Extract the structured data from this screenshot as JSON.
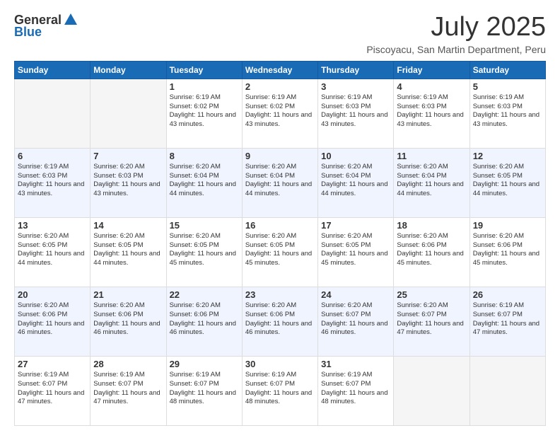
{
  "logo": {
    "general": "General",
    "blue": "Blue"
  },
  "title": "July 2025",
  "location": "Piscoyacu, San Martin Department, Peru",
  "days_of_week": [
    "Sunday",
    "Monday",
    "Tuesday",
    "Wednesday",
    "Thursday",
    "Friday",
    "Saturday"
  ],
  "weeks": [
    [
      {
        "day": "",
        "sunrise": "",
        "sunset": "",
        "daylight": ""
      },
      {
        "day": "",
        "sunrise": "",
        "sunset": "",
        "daylight": ""
      },
      {
        "day": "1",
        "sunrise": "Sunrise: 6:19 AM",
        "sunset": "Sunset: 6:02 PM",
        "daylight": "Daylight: 11 hours and 43 minutes."
      },
      {
        "day": "2",
        "sunrise": "Sunrise: 6:19 AM",
        "sunset": "Sunset: 6:02 PM",
        "daylight": "Daylight: 11 hours and 43 minutes."
      },
      {
        "day": "3",
        "sunrise": "Sunrise: 6:19 AM",
        "sunset": "Sunset: 6:03 PM",
        "daylight": "Daylight: 11 hours and 43 minutes."
      },
      {
        "day": "4",
        "sunrise": "Sunrise: 6:19 AM",
        "sunset": "Sunset: 6:03 PM",
        "daylight": "Daylight: 11 hours and 43 minutes."
      },
      {
        "day": "5",
        "sunrise": "Sunrise: 6:19 AM",
        "sunset": "Sunset: 6:03 PM",
        "daylight": "Daylight: 11 hours and 43 minutes."
      }
    ],
    [
      {
        "day": "6",
        "sunrise": "Sunrise: 6:19 AM",
        "sunset": "Sunset: 6:03 PM",
        "daylight": "Daylight: 11 hours and 43 minutes."
      },
      {
        "day": "7",
        "sunrise": "Sunrise: 6:20 AM",
        "sunset": "Sunset: 6:03 PM",
        "daylight": "Daylight: 11 hours and 43 minutes."
      },
      {
        "day": "8",
        "sunrise": "Sunrise: 6:20 AM",
        "sunset": "Sunset: 6:04 PM",
        "daylight": "Daylight: 11 hours and 44 minutes."
      },
      {
        "day": "9",
        "sunrise": "Sunrise: 6:20 AM",
        "sunset": "Sunset: 6:04 PM",
        "daylight": "Daylight: 11 hours and 44 minutes."
      },
      {
        "day": "10",
        "sunrise": "Sunrise: 6:20 AM",
        "sunset": "Sunset: 6:04 PM",
        "daylight": "Daylight: 11 hours and 44 minutes."
      },
      {
        "day": "11",
        "sunrise": "Sunrise: 6:20 AM",
        "sunset": "Sunset: 6:04 PM",
        "daylight": "Daylight: 11 hours and 44 minutes."
      },
      {
        "day": "12",
        "sunrise": "Sunrise: 6:20 AM",
        "sunset": "Sunset: 6:05 PM",
        "daylight": "Daylight: 11 hours and 44 minutes."
      }
    ],
    [
      {
        "day": "13",
        "sunrise": "Sunrise: 6:20 AM",
        "sunset": "Sunset: 6:05 PM",
        "daylight": "Daylight: 11 hours and 44 minutes."
      },
      {
        "day": "14",
        "sunrise": "Sunrise: 6:20 AM",
        "sunset": "Sunset: 6:05 PM",
        "daylight": "Daylight: 11 hours and 44 minutes."
      },
      {
        "day": "15",
        "sunrise": "Sunrise: 6:20 AM",
        "sunset": "Sunset: 6:05 PM",
        "daylight": "Daylight: 11 hours and 45 minutes."
      },
      {
        "day": "16",
        "sunrise": "Sunrise: 6:20 AM",
        "sunset": "Sunset: 6:05 PM",
        "daylight": "Daylight: 11 hours and 45 minutes."
      },
      {
        "day": "17",
        "sunrise": "Sunrise: 6:20 AM",
        "sunset": "Sunset: 6:05 PM",
        "daylight": "Daylight: 11 hours and 45 minutes."
      },
      {
        "day": "18",
        "sunrise": "Sunrise: 6:20 AM",
        "sunset": "Sunset: 6:06 PM",
        "daylight": "Daylight: 11 hours and 45 minutes."
      },
      {
        "day": "19",
        "sunrise": "Sunrise: 6:20 AM",
        "sunset": "Sunset: 6:06 PM",
        "daylight": "Daylight: 11 hours and 45 minutes."
      }
    ],
    [
      {
        "day": "20",
        "sunrise": "Sunrise: 6:20 AM",
        "sunset": "Sunset: 6:06 PM",
        "daylight": "Daylight: 11 hours and 46 minutes."
      },
      {
        "day": "21",
        "sunrise": "Sunrise: 6:20 AM",
        "sunset": "Sunset: 6:06 PM",
        "daylight": "Daylight: 11 hours and 46 minutes."
      },
      {
        "day": "22",
        "sunrise": "Sunrise: 6:20 AM",
        "sunset": "Sunset: 6:06 PM",
        "daylight": "Daylight: 11 hours and 46 minutes."
      },
      {
        "day": "23",
        "sunrise": "Sunrise: 6:20 AM",
        "sunset": "Sunset: 6:06 PM",
        "daylight": "Daylight: 11 hours and 46 minutes."
      },
      {
        "day": "24",
        "sunrise": "Sunrise: 6:20 AM",
        "sunset": "Sunset: 6:07 PM",
        "daylight": "Daylight: 11 hours and 46 minutes."
      },
      {
        "day": "25",
        "sunrise": "Sunrise: 6:20 AM",
        "sunset": "Sunset: 6:07 PM",
        "daylight": "Daylight: 11 hours and 47 minutes."
      },
      {
        "day": "26",
        "sunrise": "Sunrise: 6:19 AM",
        "sunset": "Sunset: 6:07 PM",
        "daylight": "Daylight: 11 hours and 47 minutes."
      }
    ],
    [
      {
        "day": "27",
        "sunrise": "Sunrise: 6:19 AM",
        "sunset": "Sunset: 6:07 PM",
        "daylight": "Daylight: 11 hours and 47 minutes."
      },
      {
        "day": "28",
        "sunrise": "Sunrise: 6:19 AM",
        "sunset": "Sunset: 6:07 PM",
        "daylight": "Daylight: 11 hours and 47 minutes."
      },
      {
        "day": "29",
        "sunrise": "Sunrise: 6:19 AM",
        "sunset": "Sunset: 6:07 PM",
        "daylight": "Daylight: 11 hours and 48 minutes."
      },
      {
        "day": "30",
        "sunrise": "Sunrise: 6:19 AM",
        "sunset": "Sunset: 6:07 PM",
        "daylight": "Daylight: 11 hours and 48 minutes."
      },
      {
        "day": "31",
        "sunrise": "Sunrise: 6:19 AM",
        "sunset": "Sunset: 6:07 PM",
        "daylight": "Daylight: 11 hours and 48 minutes."
      },
      {
        "day": "",
        "sunrise": "",
        "sunset": "",
        "daylight": ""
      },
      {
        "day": "",
        "sunrise": "",
        "sunset": "",
        "daylight": ""
      }
    ]
  ]
}
